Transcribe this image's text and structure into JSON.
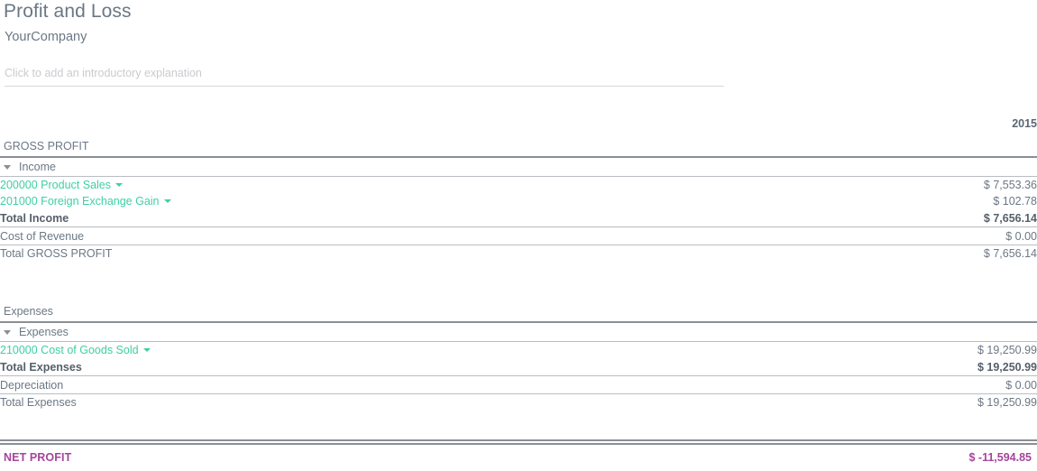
{
  "header": {
    "title": "Profit and Loss",
    "company": "YourCompany",
    "intro_placeholder": "Click to add an introductory explanation"
  },
  "table": {
    "period_column_header": "2015",
    "sections": [
      {
        "name": "gross-profit",
        "title": "GROSS PROFIT",
        "group": {
          "label": "Income",
          "caret": "chevron-down-icon"
        },
        "accounts": [
          {
            "label": "200000 Product Sales",
            "value": "$ 7,553.36",
            "caret": "chevron-down-icon"
          },
          {
            "label": "201000 Foreign Exchange Gain",
            "value": "$ 102.78",
            "caret": "chevron-down-icon"
          }
        ],
        "group_total": {
          "label": "Total Income",
          "value": "$ 7,656.14"
        },
        "extra_lines": [
          {
            "label": "Cost of Revenue",
            "value": "$ 0.00"
          }
        ],
        "section_total": {
          "label": "Total GROSS PROFIT",
          "value": "$ 7,656.14"
        }
      },
      {
        "name": "expenses",
        "title": "Expenses",
        "group": {
          "label": "Expenses",
          "caret": "chevron-down-icon"
        },
        "accounts": [
          {
            "label": "210000 Cost of Goods Sold",
            "value": "$ 19,250.99",
            "caret": "chevron-down-icon"
          }
        ],
        "group_total": {
          "label": "Total Expenses",
          "value": "$ 19,250.99"
        },
        "extra_lines": [
          {
            "label": "Depreciation",
            "value": "$ 0.00"
          }
        ],
        "section_total": {
          "label": "Total Expenses",
          "value": "$ 19,250.99"
        }
      }
    ]
  },
  "net_profit": {
    "label": "NET PROFIT",
    "value": "$ -11,594.85",
    "color": "#a5459b"
  },
  "colors": {
    "text": "#6b7785",
    "link_teal": "#3fcfa4",
    "rule": "#b9bdc2",
    "rule_strong": "#8a8f96",
    "placeholder": "#c9cbce",
    "net_profit": "#a5459b"
  }
}
